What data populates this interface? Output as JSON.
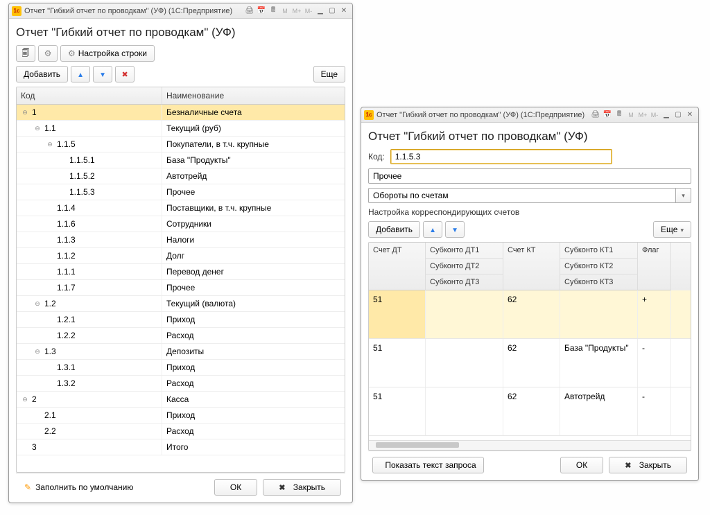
{
  "window1": {
    "titlebar": "Отчет \"Гибкий отчет по проводкам\" (УФ)  (1С:Предприятие)",
    "heading": "Отчет \"Гибкий отчет по проводкам\" (УФ)",
    "settings_btn": "Настройка строки",
    "add_btn": "Добавить",
    "more_btn": "Еще",
    "col_code": "Код",
    "col_name": "Наименование",
    "tree": [
      {
        "lvl": 0,
        "exp": "open",
        "code": "1",
        "name": "Безналичные счета",
        "sel": true
      },
      {
        "lvl": 1,
        "exp": "open",
        "code": "1.1",
        "name": "Текущий (руб)"
      },
      {
        "lvl": 2,
        "exp": "open",
        "code": "1.1.5",
        "name": "Покупатели, в т.ч. крупные"
      },
      {
        "lvl": 3,
        "exp": "",
        "code": "1.1.5.1",
        "name": "База \"Продукты\""
      },
      {
        "lvl": 3,
        "exp": "",
        "code": "1.1.5.2",
        "name": "Автотрейд"
      },
      {
        "lvl": 3,
        "exp": "",
        "code": "1.1.5.3",
        "name": "Прочее"
      },
      {
        "lvl": 2,
        "exp": "",
        "code": "1.1.4",
        "name": "Поставщики, в т.ч. крупные"
      },
      {
        "lvl": 2,
        "exp": "",
        "code": "1.1.6",
        "name": "Сотрудники"
      },
      {
        "lvl": 2,
        "exp": "",
        "code": "1.1.3",
        "name": "Налоги"
      },
      {
        "lvl": 2,
        "exp": "",
        "code": "1.1.2",
        "name": "Долг"
      },
      {
        "lvl": 2,
        "exp": "",
        "code": "1.1.1",
        "name": "Перевод денег"
      },
      {
        "lvl": 2,
        "exp": "",
        "code": "1.1.7",
        "name": "Прочее"
      },
      {
        "lvl": 1,
        "exp": "open",
        "code": "1.2",
        "name": "Текущий (валюта)"
      },
      {
        "lvl": 2,
        "exp": "",
        "code": "1.2.1",
        "name": "Приход"
      },
      {
        "lvl": 2,
        "exp": "",
        "code": "1.2.2",
        "name": "Расход"
      },
      {
        "lvl": 1,
        "exp": "open",
        "code": "1.3",
        "name": "Депозиты"
      },
      {
        "lvl": 2,
        "exp": "",
        "code": "1.3.1",
        "name": "Приход"
      },
      {
        "lvl": 2,
        "exp": "",
        "code": "1.3.2",
        "name": "Расход"
      },
      {
        "lvl": 0,
        "exp": "open",
        "code": "2",
        "name": "Касса"
      },
      {
        "lvl": 1,
        "exp": "",
        "code": "2.1",
        "name": "Приход"
      },
      {
        "lvl": 1,
        "exp": "",
        "code": "2.2",
        "name": "Расход"
      },
      {
        "lvl": 0,
        "exp": "",
        "code": "3",
        "name": "Итого"
      }
    ],
    "fill_default": "Заполнить по умолчанию",
    "ok_btn": "ОК",
    "close_btn": "Закрыть"
  },
  "window2": {
    "titlebar": "Отчет \"Гибкий отчет по проводкам\" (УФ)  (1С:Предприятие)",
    "heading": "Отчет \"Гибкий отчет по проводкам\" (УФ)",
    "code_label": "Код:",
    "code_value": "1.1.5.3",
    "name_value": "Прочее",
    "type_value": "Обороты по счетам",
    "corr_label": "Настройка корреспондирующих счетов",
    "add_btn": "Добавить",
    "more_btn": "Еще",
    "grid_head": {
      "c1": "Счет ДТ",
      "c2a": "Субконто ДТ1",
      "c2b": "Субконто ДТ2",
      "c2c": "Субконто ДТ3",
      "c3": "Счет КТ",
      "c4a": "Субконто КТ1",
      "c4b": "Субконто КТ2",
      "c4c": "Субконто КТ3",
      "c5": "Флаг"
    },
    "grid_rows": [
      {
        "dt": "51",
        "sdt": "",
        "kt": "62",
        "skt": "",
        "flag": "+",
        "sel": true
      },
      {
        "dt": "51",
        "sdt": "",
        "kt": "62",
        "skt": "База \"Продукты\"",
        "flag": "-"
      },
      {
        "dt": "51",
        "sdt": "",
        "kt": "62",
        "skt": "Автотрейд",
        "flag": "-"
      }
    ],
    "show_query": "Показать текст запроса",
    "ok_btn": "ОК",
    "close_btn": "Закрыть"
  },
  "tb_icons": {
    "m": "M",
    "mplus": "M+",
    "mminus": "M-"
  }
}
